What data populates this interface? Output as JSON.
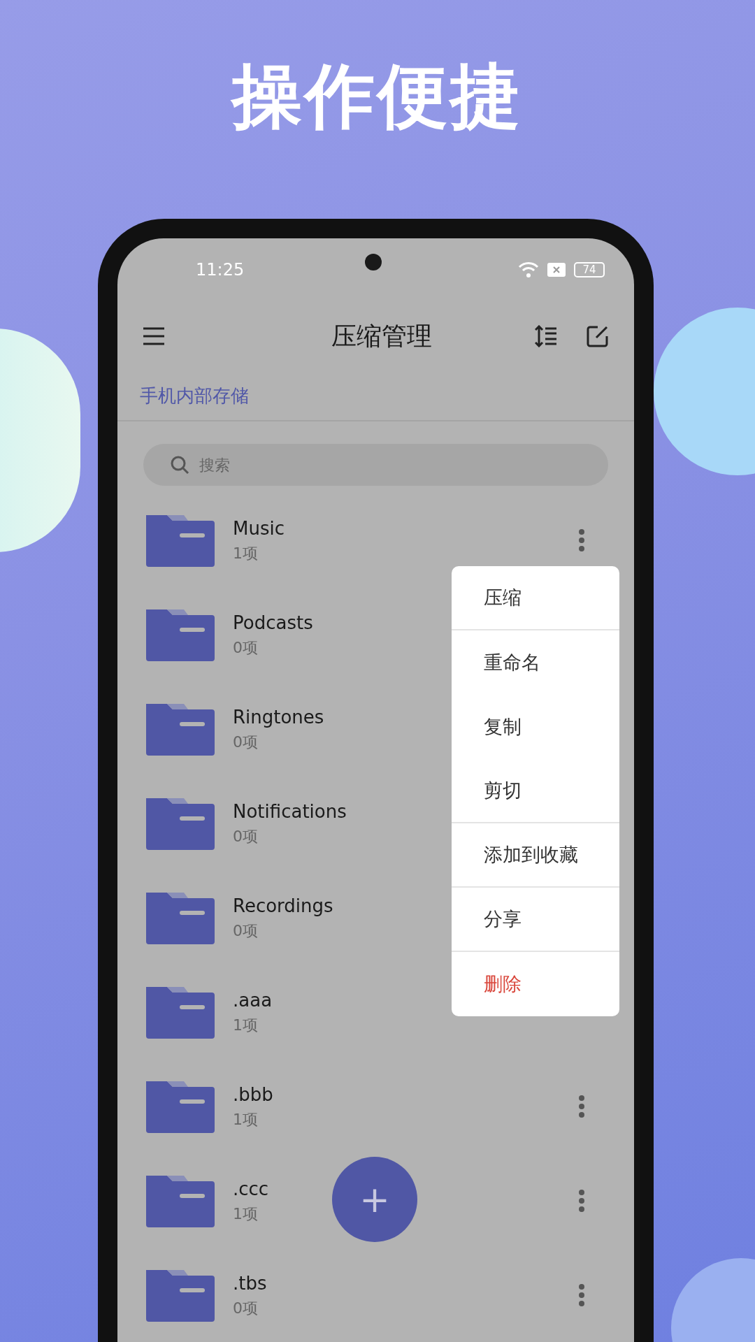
{
  "headline": "操作便捷",
  "status_bar": {
    "time": "11:25",
    "battery": "74"
  },
  "toolbar": {
    "title": "压缩管理"
  },
  "storage_label": "手机内部存储",
  "search": {
    "placeholder": "搜索"
  },
  "rows": [
    {
      "name": "Music",
      "count": "1项",
      "has_menu_button": true
    },
    {
      "name": "Podcasts",
      "count": "0项",
      "has_menu_button": false
    },
    {
      "name": "Ringtones",
      "count": "0项",
      "has_menu_button": false
    },
    {
      "name": "Notifications",
      "count": "0项",
      "has_menu_button": false
    },
    {
      "name": "Recordings",
      "count": "0项",
      "has_menu_button": false
    },
    {
      "name": ".aaa",
      "count": "1项",
      "has_menu_button": false
    },
    {
      "name": ".bbb",
      "count": "1项",
      "has_menu_button": true
    },
    {
      "name": ".ccc",
      "count": "1项",
      "has_menu_button": true
    },
    {
      "name": ".tbs",
      "count": "0项",
      "has_menu_button": true
    }
  ],
  "context_menu": [
    {
      "label": "压缩",
      "kind": "normal",
      "divider_after": true
    },
    {
      "label": "重命名",
      "kind": "normal",
      "divider_after": false
    },
    {
      "label": "复制",
      "kind": "normal",
      "divider_after": false
    },
    {
      "label": "剪切",
      "kind": "normal",
      "divider_after": true
    },
    {
      "label": "添加到收藏",
      "kind": "normal",
      "divider_after": true
    },
    {
      "label": "分享",
      "kind": "normal",
      "divider_after": true
    },
    {
      "label": "删除",
      "kind": "danger",
      "divider_after": false
    }
  ],
  "fab": {
    "label": "+"
  }
}
